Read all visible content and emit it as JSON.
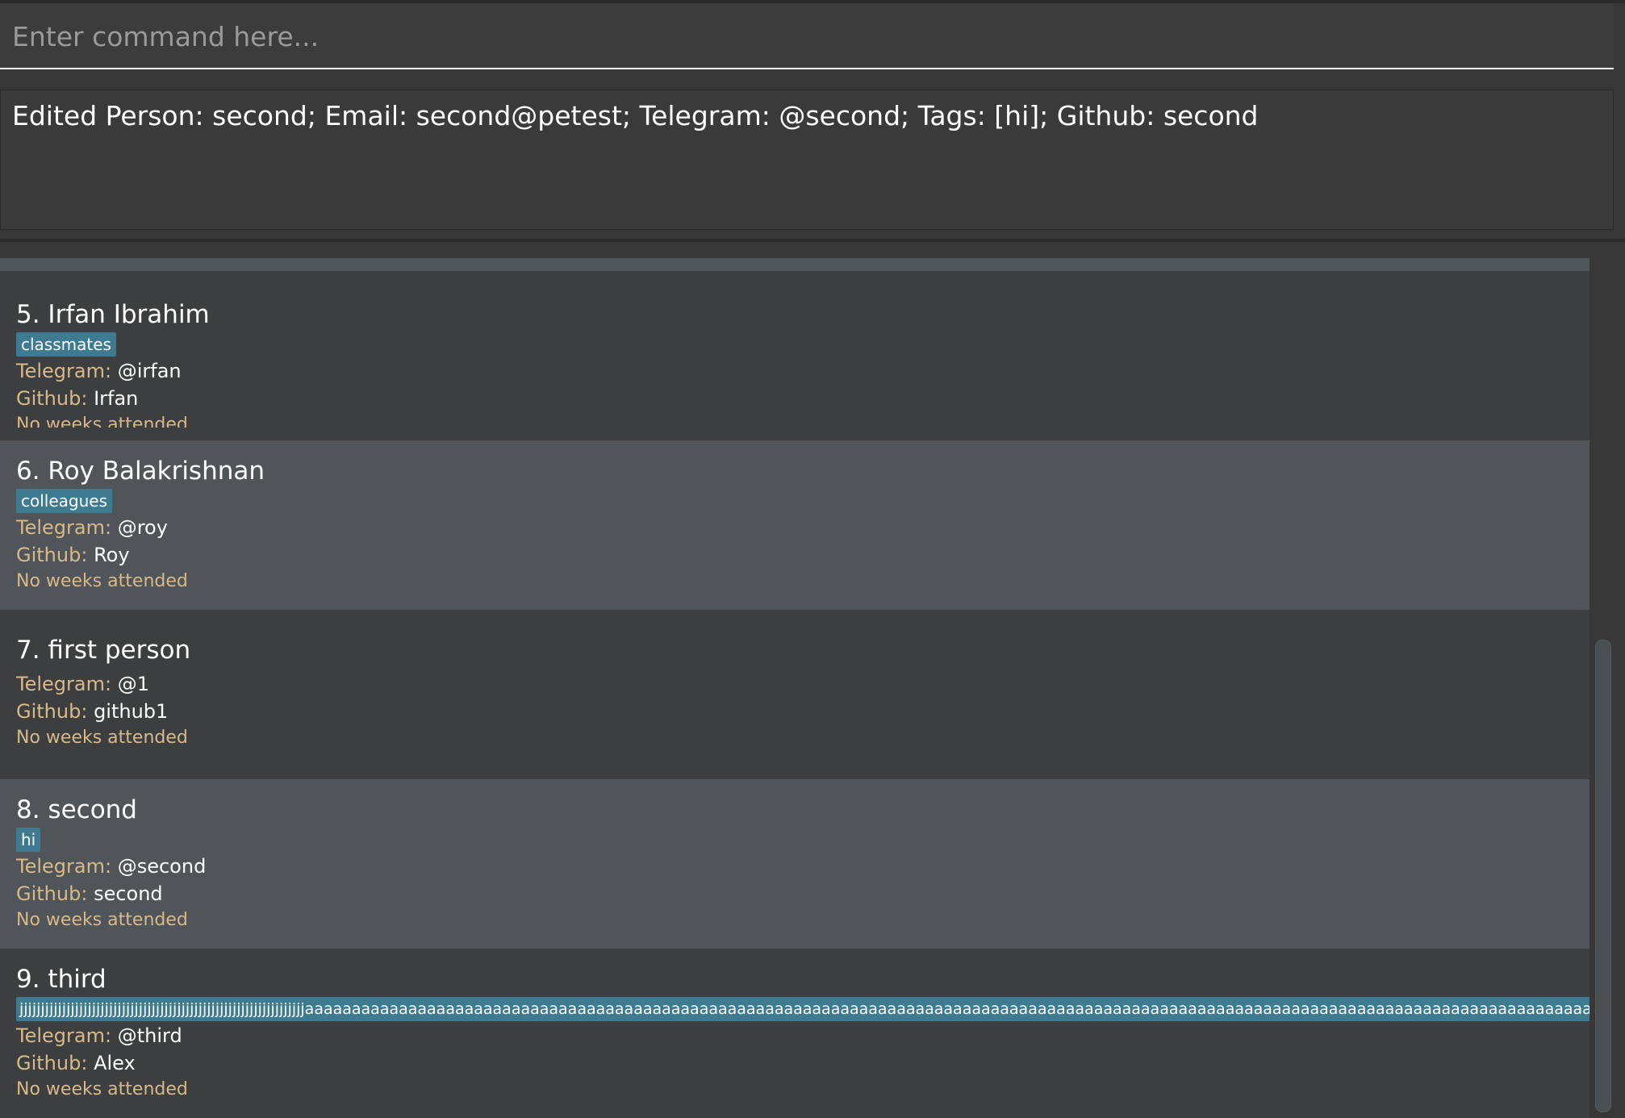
{
  "command_box": {
    "placeholder": "Enter command here..."
  },
  "result_display": {
    "text": "Edited Person: second; Email: second@petest; Telegram: @second; Tags: [hi]; Github: second"
  },
  "labels": {
    "telegram": "Telegram:",
    "github": "Github:"
  },
  "persons": [
    {
      "name": "5. Irfan Ibrahim",
      "tag": "classmates",
      "telegram": "@irfan",
      "github": "Irfan",
      "attendance": "No weeks attended"
    },
    {
      "name": "6. Roy Balakrishnan",
      "tag": "colleagues",
      "telegram": "@roy",
      "github": "Roy",
      "attendance": "No weeks attended"
    },
    {
      "name": "7. first person",
      "telegram": "@1",
      "github": "github1",
      "attendance": "No weeks attended"
    },
    {
      "name": "8. second",
      "tag": "hi",
      "telegram": "@second",
      "github": "second",
      "attendance": "No weeks attended"
    },
    {
      "name": "9. third",
      "tag": "jjjjjjjjjjjjjjjjjjjjjjjjjjjjjjjjjjjjjjjjjjjjjjjjjjjjjjjjjjjjjjjjjjjaaaaaaaaaaaaaaaaaaaaaaaaaaaaaaaaaaaaaaaaaaaaaaaaaaaaaaaaaaaaaaaaaaaaaaaaaaaaaaaaaaaaaaaaaaaaaaaaaaaaaaaaaaaaaaaaaaaaaaaaaaaaaaaaaaaaaaaaaaaaaaaaaaaaaaaaaaaaaa",
      "telegram": "@third",
      "github": "Alex",
      "attendance": "No weeks attended"
    }
  ],
  "colors": {
    "background": "#383838",
    "card_dark": "#3c3e40",
    "card_light": "#4f5559",
    "tag": "#3e7b91",
    "label": "#d7b98a"
  }
}
